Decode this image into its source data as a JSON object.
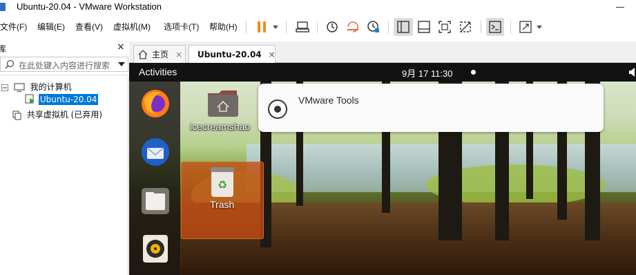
{
  "window": {
    "title": "Ubuntu-20.04 - VMware Workstation",
    "app_icon": "vmware-icon"
  },
  "menu": {
    "items": [
      "文件(F)",
      "编辑(E)",
      "查看(V)",
      "虚拟机(M)",
      "选项卡(T)",
      "帮助(H)"
    ]
  },
  "toolbar": {
    "icons": [
      "pause-icon",
      "dropdown-arrow-icon",
      "send-keys-icon",
      "snapshot-icon",
      "revert-snapshot-icon",
      "snapshot-manager-icon",
      "library-view-icon",
      "thumbnail-view-icon",
      "fullscreen-icon",
      "unity-icon",
      "console-icon",
      "stretch-icon",
      "dropdown-arrow-icon"
    ],
    "accent": "#f28a1e"
  },
  "library": {
    "header_label": "库",
    "close_label": "×",
    "search_placeholder": "在此处键入内容进行搜索",
    "tree": {
      "my_computer": "我的计算机",
      "vm": "Ubuntu-20.04",
      "shared": "共享虚拟机 (已弃用)"
    },
    "selected_color": "#0078d7"
  },
  "tabs": [
    {
      "label": "主页",
      "icon": "home-icon",
      "active": false
    },
    {
      "label": "Ubuntu-20.04",
      "icon": "vm-icon",
      "active": true
    }
  ],
  "tab_close": "×",
  "guest": {
    "topbar": {
      "activities": "Activities",
      "clock": "9月 17  11:30",
      "icons": [
        "notification-dot-icon",
        "volume-icon"
      ]
    },
    "dock": [
      "firefox-icon",
      "thunderbird-icon",
      "files-icon",
      "rhythmbox-icon"
    ],
    "desktop": {
      "home_folder_label": "icecreamshao",
      "trash_label": "Trash"
    },
    "notification": {
      "text": "VMware Tools",
      "icon": "disc-icon"
    }
  }
}
